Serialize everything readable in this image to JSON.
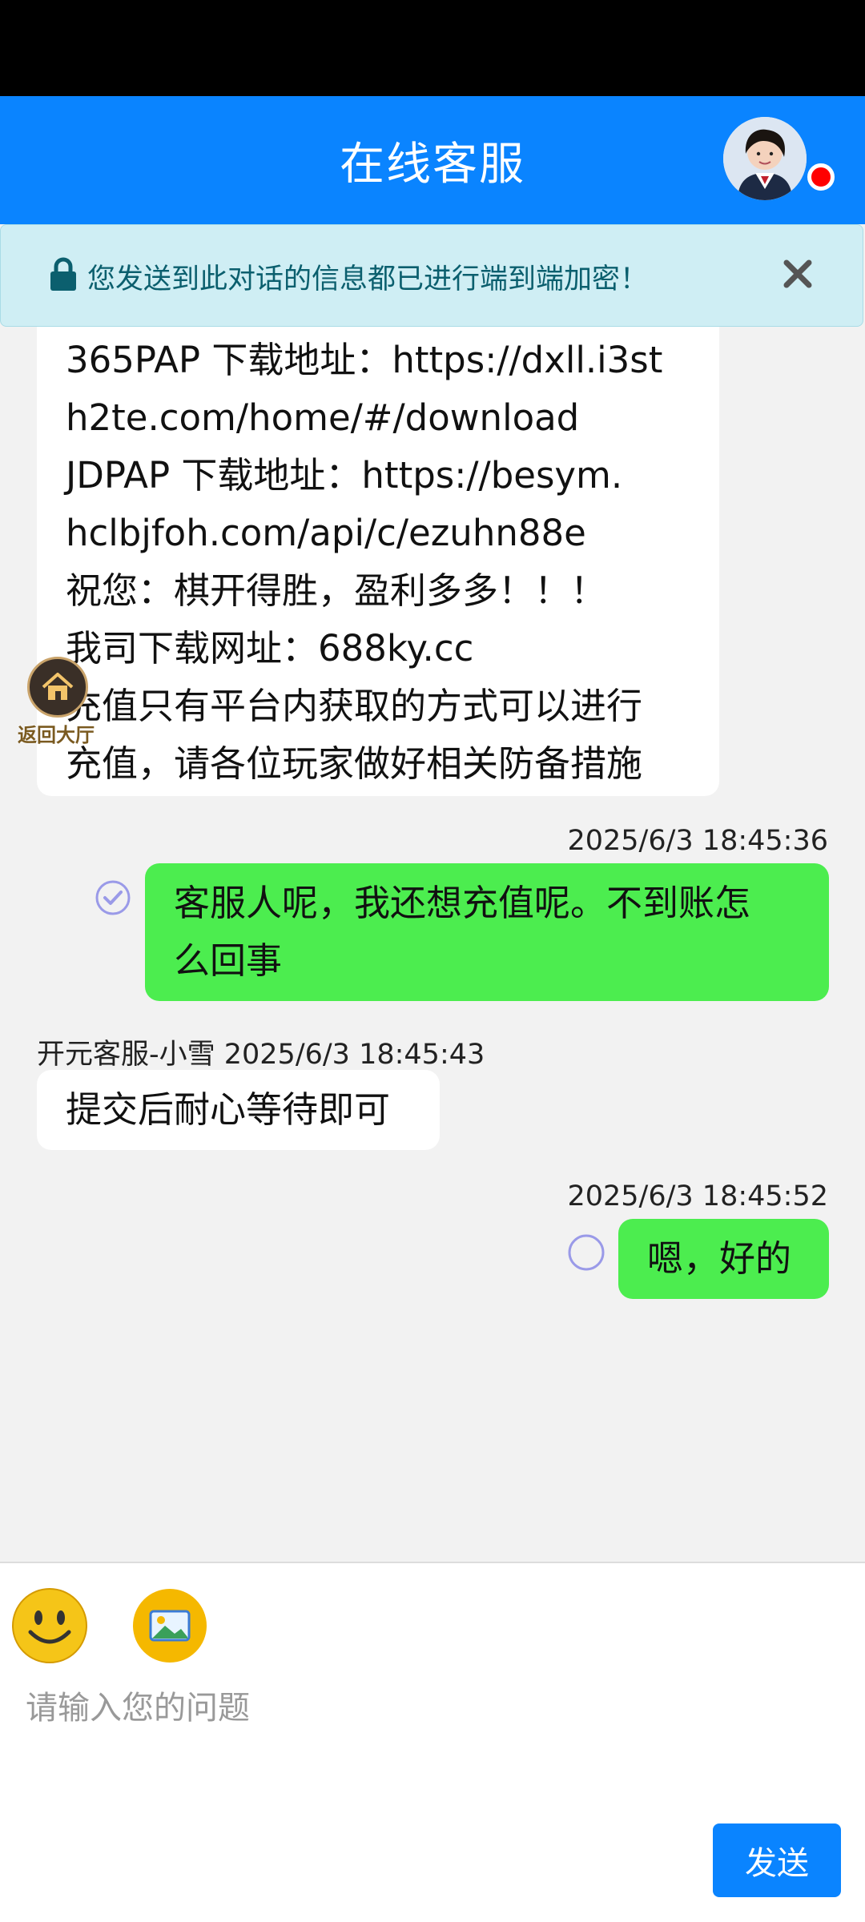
{
  "header": {
    "title": "在线客服"
  },
  "notice": {
    "text": "您发送到此对话的信息都已进行端到端加密！"
  },
  "messages": [
    {
      "side": "in",
      "lines": [
        "365PAP 下载地址：https://dxll.i3st",
        "h2te.com/home/#/download",
        "JDPAP   下载地址：https://besym.",
        "hclbjfoh.com/api/c/ezuhn88e",
        "祝您：棋开得胜，盈利多多！！！",
        "我司下载网址：688ky.cc",
        "充值只有平台内获取的方式可以进行",
        "充值，请各位玩家做好相关防备措施"
      ]
    },
    {
      "side": "out",
      "time": "2025/6/3 18:45:36",
      "status": "read",
      "lines": [
        "客服人呢，我还想充值呢。不到账怎",
        "么回事"
      ]
    },
    {
      "side": "in",
      "meta": "开元客服-小雪 2025/6/3 18:45:43",
      "lines": [
        "提交后耐心等待即可"
      ]
    },
    {
      "side": "out",
      "time": "2025/6/3 18:45:52",
      "status": "unread",
      "lines": [
        "嗯，好的"
      ]
    }
  ],
  "float": {
    "home_label": "返回大厅"
  },
  "composer": {
    "placeholder": "请输入您的问题",
    "send_label": "发送",
    "emoji_icon": "smiley-emoji-icon",
    "image_icon": "image-upload-icon"
  },
  "colors": {
    "header": "#0a84ff",
    "outgoing_bubble": "#4ced4f",
    "incoming_bubble": "#ffffff",
    "notice_bg": "#cfeef4"
  }
}
